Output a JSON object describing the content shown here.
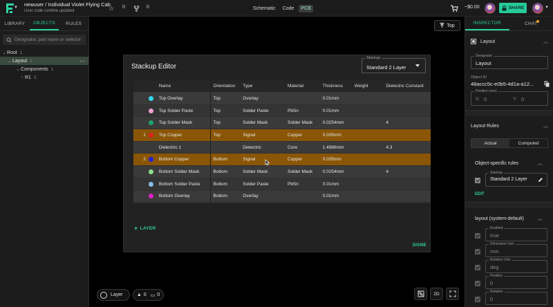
{
  "topbar": {
    "project_title": "newuser / Individual Violet Flying Cab",
    "project_subtitle": "User code runtime updated",
    "star_count": "0",
    "fork_count": "0",
    "mode_tabs": [
      "Schematic",
      "Code",
      "PCB"
    ],
    "active_mode": "PCB",
    "balance": "~$0.00",
    "share_label": "SHARE"
  },
  "left_panel": {
    "tabs": [
      "LIBRARY",
      "OBJECTS",
      "RULES"
    ],
    "active_tab": "OBJECTS",
    "search_placeholder": "Designator, part name or selector",
    "tree": [
      {
        "label": "Root",
        "count": "1"
      },
      {
        "label": "Layout",
        "count": "1"
      },
      {
        "label": "Components",
        "count": "1"
      },
      {
        "label": "R1",
        "count": "2"
      }
    ]
  },
  "canvas": {
    "side_label": "Top",
    "layer_label": "Layer",
    "warnings": "0",
    "comments": "0",
    "view_2d": "2D"
  },
  "modal": {
    "title": "Stackup Editor",
    "stackup_label": "Stackup",
    "stackup_value": "Standard 2 Layer",
    "columns": [
      "Name",
      "Orientation",
      "Type",
      "Material",
      "Thickness",
      "Weight",
      "Dielectric Constant"
    ],
    "rows": [
      {
        "idx": "",
        "color": "#34d8f0",
        "name": "Top Overlay",
        "orientation": "Top",
        "type": "Overlay",
        "material": "",
        "thickness": "0.01mm",
        "weight": "",
        "dielectric": "",
        "selected": false
      },
      {
        "idx": "",
        "color": "#f2a0d4",
        "name": "Top Solder Paste",
        "orientation": "Top",
        "type": "Solder Paste",
        "material": "PbSn",
        "thickness": "0.01mm",
        "weight": "",
        "dielectric": "",
        "selected": false
      },
      {
        "idx": "",
        "color": "#1fa36b",
        "name": "Top Solder Mask",
        "orientation": "Top",
        "type": "Solder Mask",
        "material": "Solder Mask",
        "thickness": "0.0254mm",
        "weight": "",
        "dielectric": "4",
        "selected": false
      },
      {
        "idx": "1",
        "color": "#e02020",
        "name": "Top Copper",
        "orientation": "Top",
        "type": "Signal",
        "material": "Copper",
        "thickness": "0.035mm",
        "weight": "",
        "dielectric": "",
        "selected": true
      },
      {
        "idx": "",
        "color": "",
        "name": "Dielectric 1",
        "orientation": "",
        "type": "Dielectric",
        "material": "Core",
        "thickness": "1.4986mm",
        "weight": "",
        "dielectric": "4.3",
        "selected": false
      },
      {
        "idx": "2",
        "color": "#2020d8",
        "name": "Bottom Copper",
        "orientation": "Bottom",
        "type": "Signal",
        "material": "Copper",
        "thickness": "0.035mm",
        "weight": "",
        "dielectric": "",
        "selected": true
      },
      {
        "idx": "",
        "color": "#8fe08a",
        "name": "Bottom Solder Mask",
        "orientation": "Bottom",
        "type": "Solder Mask",
        "material": "Solder Mask",
        "thickness": "0.0254mm",
        "weight": "",
        "dielectric": "4",
        "selected": false
      },
      {
        "idx": "",
        "color": "#86bde8",
        "name": "Bottom Solder Paste",
        "orientation": "Bottom",
        "type": "Solder Paste",
        "material": "PbSn",
        "thickness": "0.01mm",
        "weight": "",
        "dielectric": "",
        "selected": false
      },
      {
        "idx": "",
        "color": "#e020c8",
        "name": "Bottom Overlay",
        "orientation": "Bottom",
        "type": "Overlay",
        "material": "",
        "thickness": "0.01mm",
        "weight": "",
        "dielectric": "",
        "selected": false
      }
    ],
    "add_layer_label": "LAYER",
    "done_label": "DONE"
  },
  "inspector": {
    "tabs": [
      "INSPECTOR",
      "CHAT"
    ],
    "active_tab": "INSPECTOR",
    "layout_section": "Layout",
    "designator_label": "Designator",
    "designator_value": "Layout",
    "object_id_label": "Object ID",
    "object_id_value": "48accc5c-e0b5-4d1a-a12...",
    "position_label": "Position (mm)",
    "pos_x_label": "X:",
    "pos_x_value": "0",
    "pos_y_label": "Y:",
    "pos_y_value": "0",
    "rules_section": "Layout Rules",
    "seg_actual": "Actual",
    "seg_computed": "Computed",
    "object_rules_label": "Object-specific rules",
    "stackup_label": "Stackup",
    "stackup_value": "Standard 2 Layer",
    "edit_label": "EDIT",
    "system_default_label": "layout (system-default)",
    "enabled_label": "Enabled",
    "enabled_value": "true",
    "dim_unit_label": "Dimension Unit",
    "dim_unit_value": "mm",
    "rot_unit_label": "Rotation Unit",
    "rot_unit_value": "deg",
    "position2_label": "Position",
    "position2_value": "0",
    "rotation_label": "Rotation",
    "rotation_value": "0"
  },
  "colors": {
    "accent": "#2ed3a3",
    "selected_row": "#8a5606"
  }
}
